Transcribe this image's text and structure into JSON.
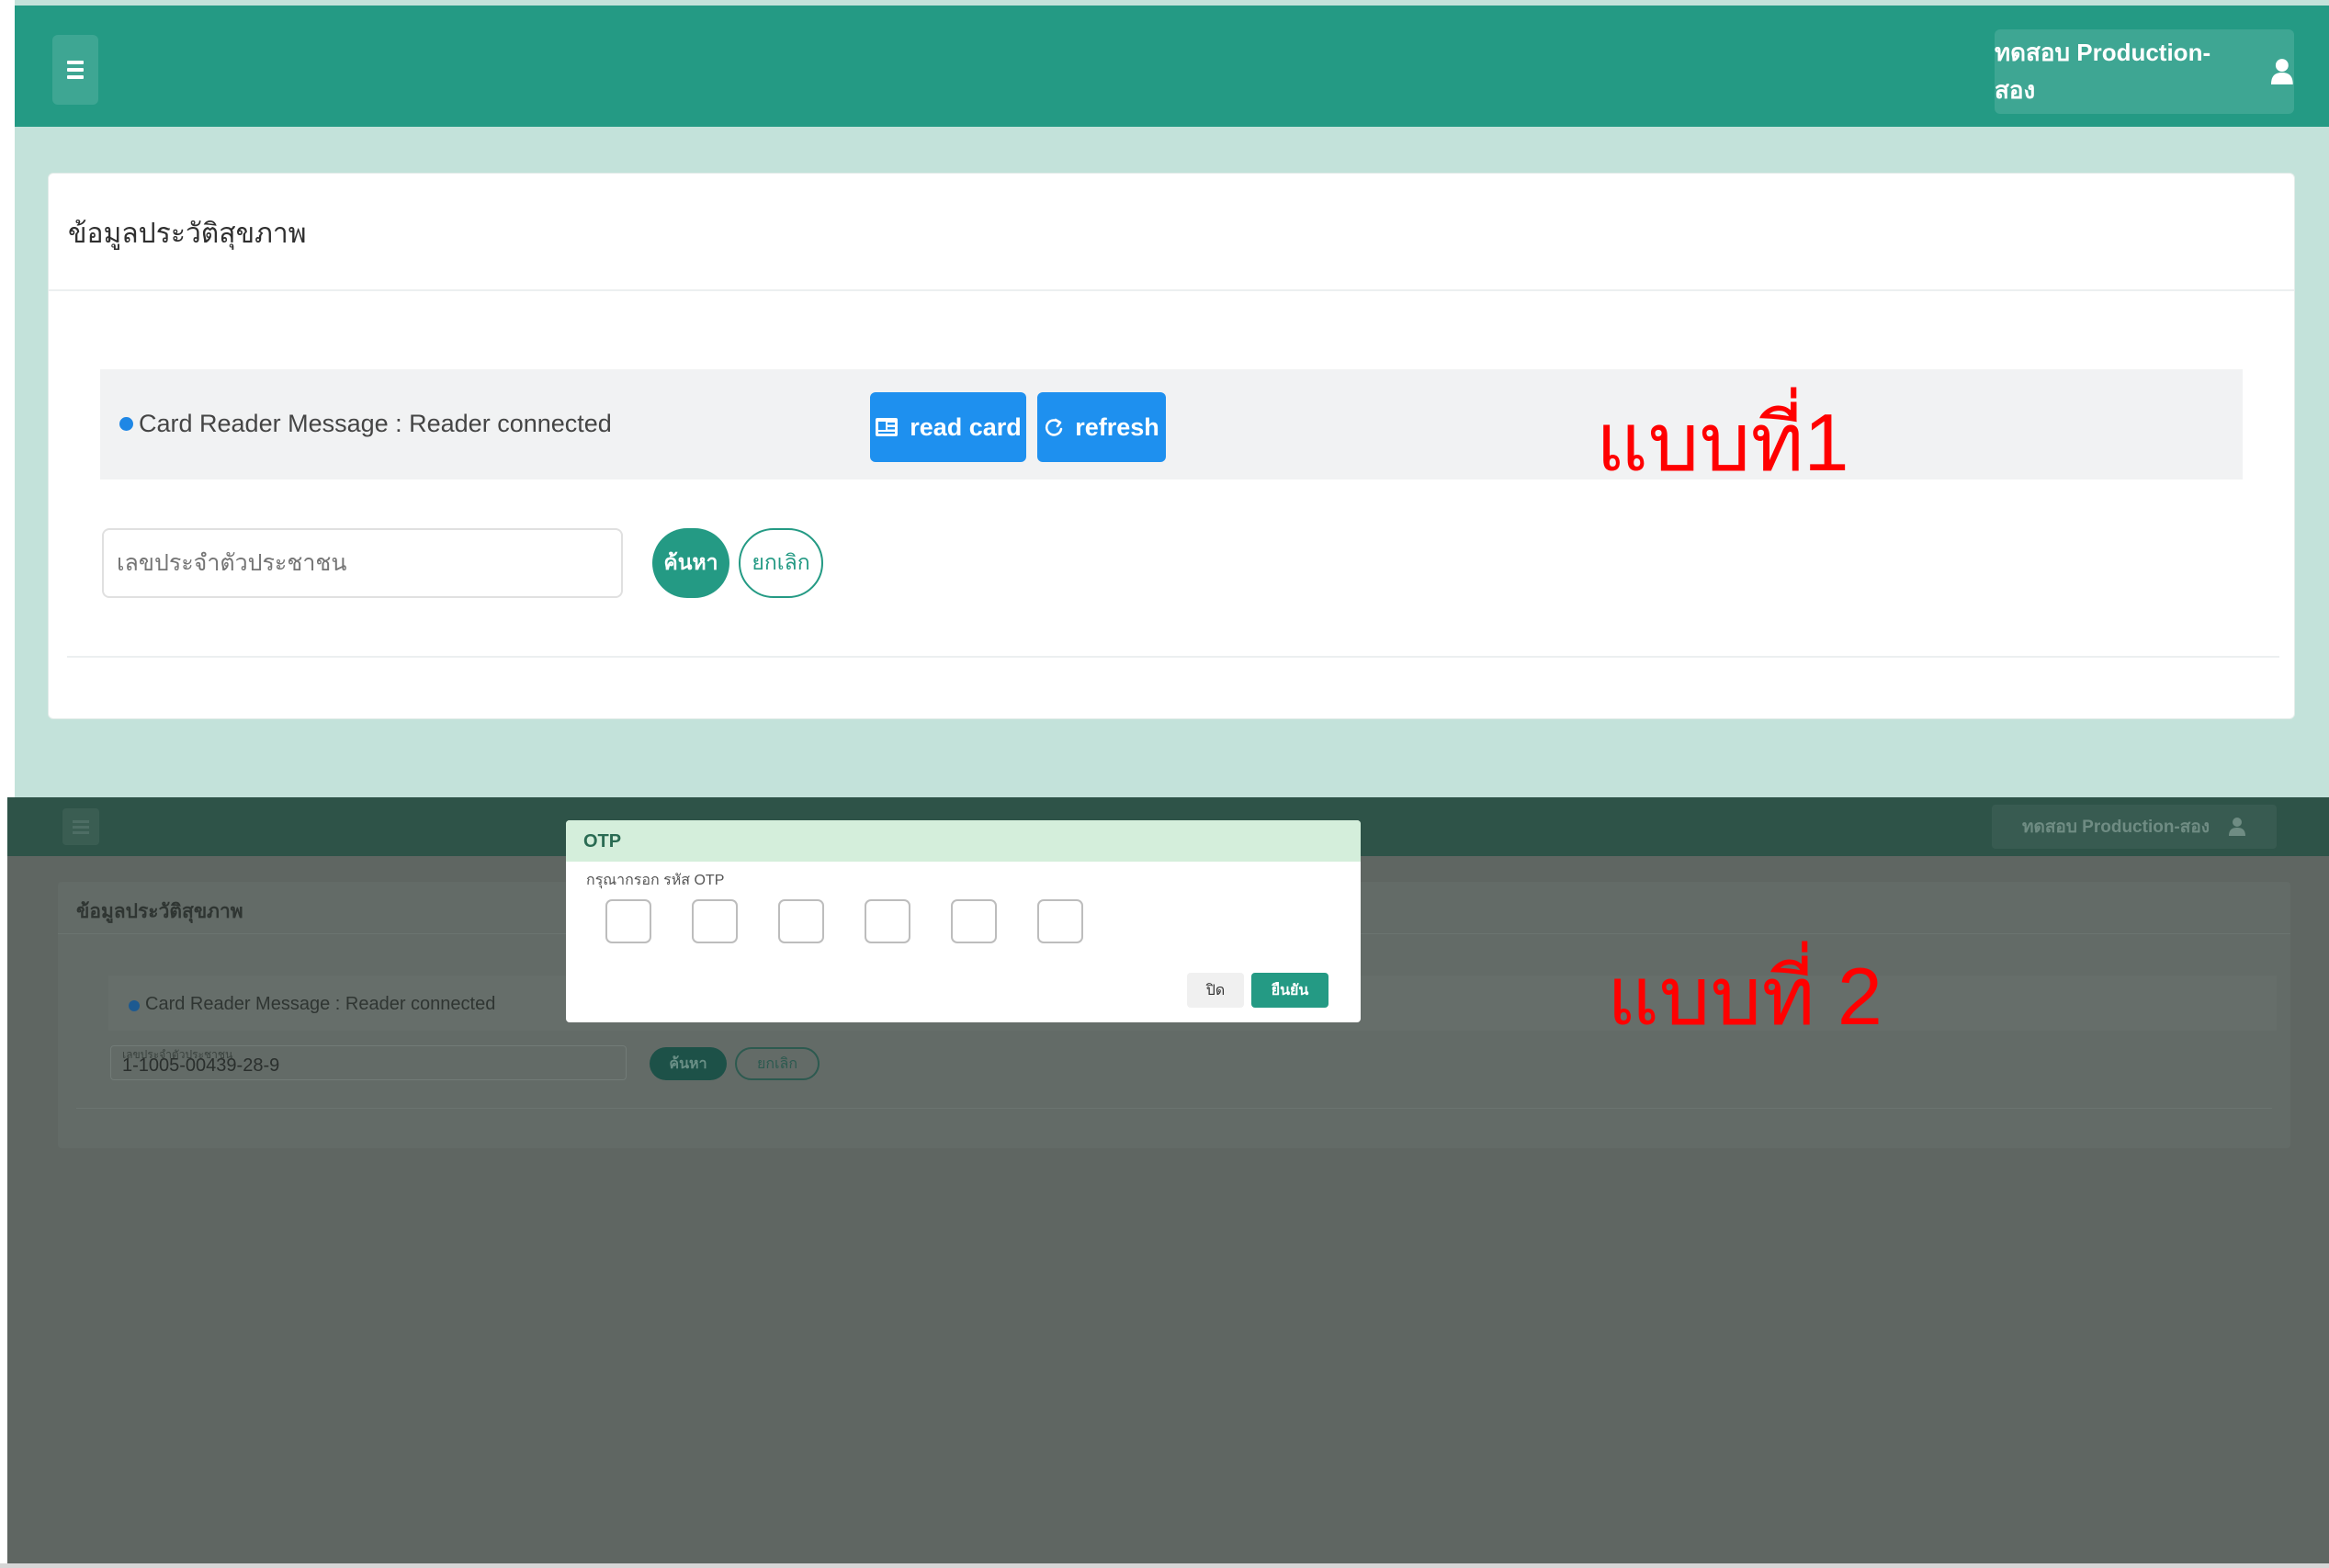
{
  "panel1": {
    "header": {
      "user_label": "ทดสอบ Production-สอง",
      "menu_icon": "hamburger-icon",
      "user_icon": "user-icon"
    },
    "page_title": "ข้อมูลประวัติสุขภาพ",
    "reader": {
      "message": "Card Reader Message : Reader connected",
      "read_card_label": "read card",
      "refresh_label": "refresh",
      "read_card_icon": "id-card-icon",
      "refresh_icon": "refresh-icon"
    },
    "search": {
      "placeholder": "เลขประจำตัวประชาชน",
      "search_label": "ค้นหา",
      "cancel_label": "ยกเลิก"
    },
    "annotation": "แบบที่1"
  },
  "panel2": {
    "header": {
      "user_label": "ทดสอบ Production-สอง",
      "menu_icon": "hamburger-icon",
      "user_icon": "user-icon"
    },
    "page_title": "ข้อมูลประวัติสุขภาพ",
    "reader": {
      "message": "Card Reader Message : Reader connected"
    },
    "search": {
      "caption": "เลขประจำตัวประชาชน",
      "value": "1-1005-00439-28-9",
      "search_label": "ค้นหา",
      "cancel_label": "ยกเลิก"
    },
    "otp_modal": {
      "title": "OTP",
      "hint": "กรุณากรอก รหัส OTP",
      "digits": [
        "",
        "",
        "",
        "",
        "",
        ""
      ],
      "close_label": "ปิด",
      "confirm_label": "ยืนยัน"
    },
    "annotation": "แบบที่ 2"
  },
  "colors": {
    "brand_green": "#249a84",
    "accent_blue": "#1e90ef",
    "annotation_red": "#ff0000",
    "modal_header": "#d4eedb"
  }
}
